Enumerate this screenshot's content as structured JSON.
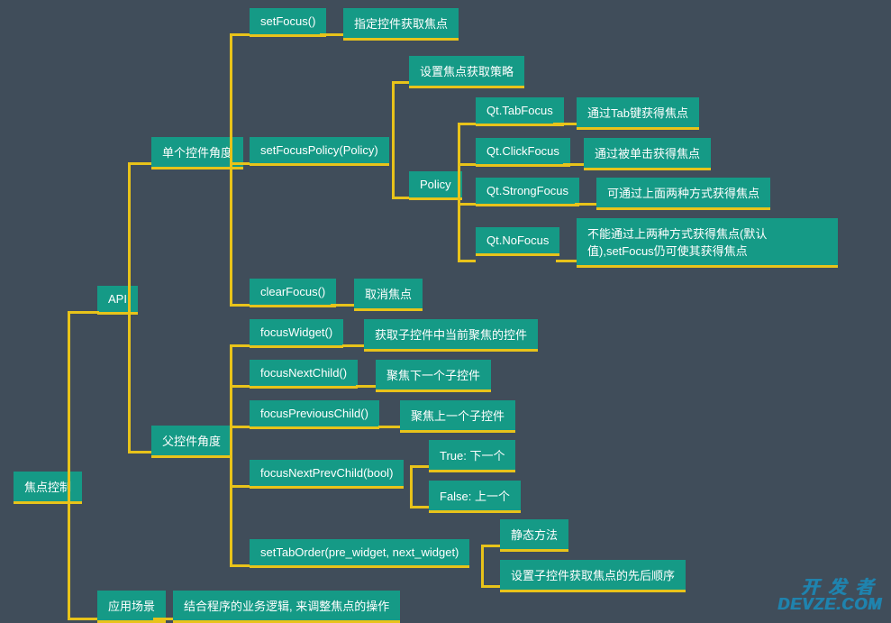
{
  "root": "焦点控制",
  "api": "API",
  "single": "单个控件角度",
  "setFocus": "setFocus()",
  "setFocus_desc": "指定控件获取焦点",
  "setFocusPolicy": "setFocusPolicy(Policy)",
  "setFocusPolicy_desc": "设置焦点获取策略",
  "policy": "Policy",
  "tabFocus": "Qt.TabFocus",
  "tabFocus_desc": "通过Tab键获得焦点",
  "clickFocus": "Qt.ClickFocus",
  "clickFocus_desc": "通过被单击获得焦点",
  "strongFocus": "Qt.StrongFocus",
  "strongFocus_desc": "可通过上面两种方式获得焦点",
  "noFocus": "Qt.NoFocus",
  "noFocus_desc": "不能通过上两种方式获得焦点(默认值),setFocus仍可使其获得焦点",
  "clearFocus": "clearFocus()",
  "clearFocus_desc": "取消焦点",
  "parent": "父控件角度",
  "focusWidget": "focusWidget()",
  "focusWidget_desc": "获取子控件中当前聚焦的控件",
  "focusNextChild": "focusNextChild()",
  "focusNextChild_desc": "聚焦下一个子控件",
  "focusPreviousChild": "focusPreviousChild()",
  "focusPreviousChild_desc": "聚焦上一个子控件",
  "focusNextPrevChild": "focusNextPrevChild(bool)",
  "fnpTrue": "True: 下一个",
  "fnpFalse": "False: 上一个",
  "setTabOrder": "setTabOrder(pre_widget, next_widget)",
  "setTabOrder_desc1": "静态方法",
  "setTabOrder_desc2": "设置子控件获取焦点的先后顺序",
  "scene": "应用场景",
  "scene_desc": "结合程序的业务逻辑, 来调整焦点的操作",
  "wm_cn": "开发者",
  "wm_en": "DEVZE.COM"
}
